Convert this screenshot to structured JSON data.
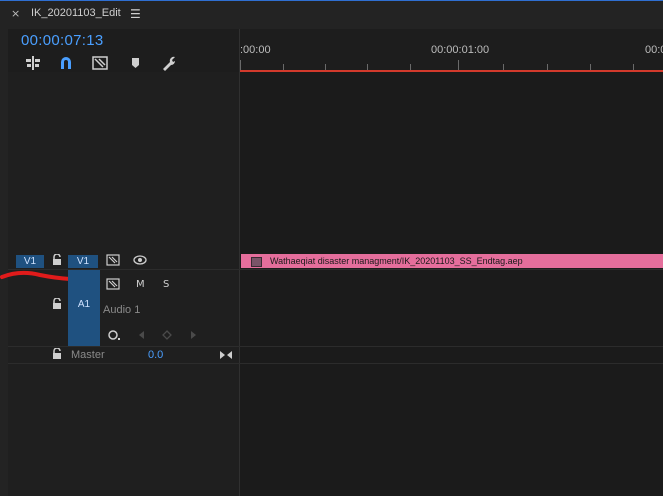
{
  "panel": {
    "close_glyph": "×",
    "sequence_name": "IK_20201103_Edit",
    "menu_glyph": "☰",
    "timecode": "00:00:07:13"
  },
  "toolbar": {
    "icons": [
      "insert-nest-icon",
      "snap-magnet-icon",
      "linked-selection-icon",
      "add-marker-icon",
      "timeline-settings-wrench-icon"
    ]
  },
  "ruler": {
    "labels": [
      ":00:00",
      "00:00:01:00",
      "00:0"
    ],
    "work_area_color": "#d33a2c"
  },
  "tracks": {
    "video": {
      "source_patch": "V1",
      "target": "V1"
    },
    "audio": {
      "target": "A1",
      "name": "Audio 1",
      "mute": "M",
      "solo": "S"
    },
    "master": {
      "label": "Master",
      "value": "0.0"
    }
  },
  "clip": {
    "label": "Wathaeqiat disaster managment/IK_20201103_SS_Endtag.aep",
    "color": "#e56e9c"
  },
  "colors": {
    "accent": "#4a9fff",
    "toggle_bg": "#1f5180",
    "annotation": "#e01b1b"
  }
}
